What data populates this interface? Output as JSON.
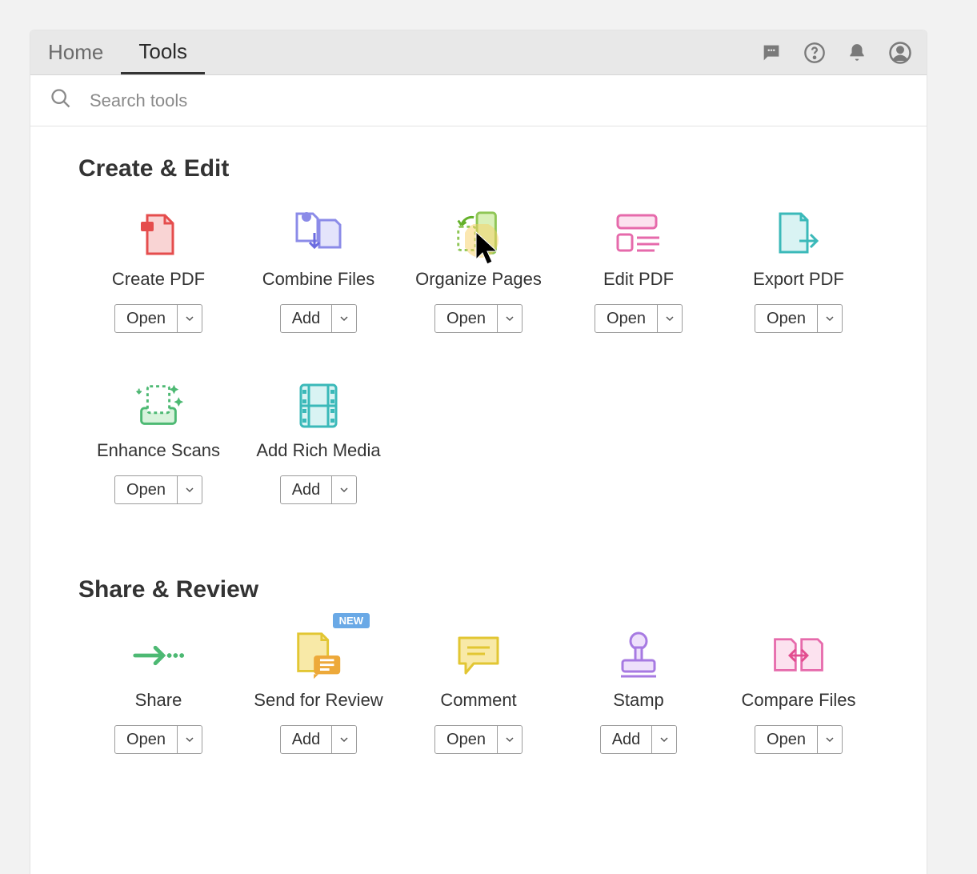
{
  "toolbar": {
    "homeLabel": "Home",
    "toolsLabel": "Tools"
  },
  "search": {
    "placeholder": "Search tools"
  },
  "sections": {
    "createEdit": {
      "title": "Create & Edit",
      "tools": [
        {
          "label": "Create PDF",
          "action": "Open",
          "icon": "create-pdf"
        },
        {
          "label": "Combine Files",
          "action": "Add",
          "icon": "combine-files"
        },
        {
          "label": "Organize Pages",
          "action": "Open",
          "icon": "organize-pages"
        },
        {
          "label": "Edit PDF",
          "action": "Open",
          "icon": "edit-pdf"
        },
        {
          "label": "Export PDF",
          "action": "Open",
          "icon": "export-pdf"
        },
        {
          "label": "Enhance Scans",
          "action": "Open",
          "icon": "enhance-scans"
        },
        {
          "label": "Add Rich Media",
          "action": "Add",
          "icon": "add-rich-media"
        }
      ]
    },
    "shareReview": {
      "title": "Share & Review",
      "tools": [
        {
          "label": "Share",
          "action": "Open",
          "icon": "share"
        },
        {
          "label": "Send for Review",
          "action": "Add",
          "icon": "send-for-review",
          "badge": "NEW"
        },
        {
          "label": "Comment",
          "action": "Open",
          "icon": "comment"
        },
        {
          "label": "Stamp",
          "action": "Add",
          "icon": "stamp"
        },
        {
          "label": "Compare Files",
          "action": "Open",
          "icon": "compare-files"
        }
      ]
    }
  },
  "badgeText": "NEW"
}
